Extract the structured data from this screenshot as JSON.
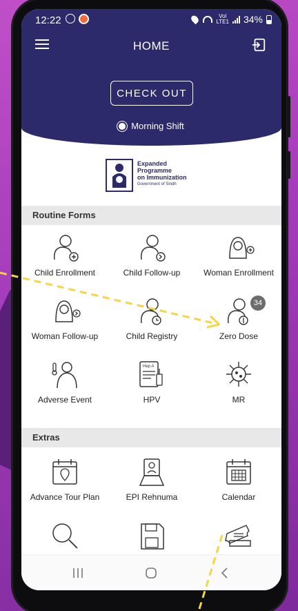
{
  "status_bar": {
    "time": "12:22",
    "battery": "34%",
    "network": "VoLTE LTE1"
  },
  "header": {
    "title": "HOME",
    "checkout_label": "CHECK OUT",
    "shift": "Morning Shift"
  },
  "logo": {
    "line1": "Expanded",
    "line2": "Programme",
    "line3": "on Immunization",
    "line4": "Government of Sindh"
  },
  "sections": {
    "routine": "Routine Forms",
    "extras": "Extras"
  },
  "routine_items": [
    {
      "label": "Child Enrollment",
      "icon": "child-plus-icon"
    },
    {
      "label": "Child Follow-up",
      "icon": "child-arrow-icon"
    },
    {
      "label": "Woman Enrollment",
      "icon": "woman-plus-icon"
    },
    {
      "label": "Woman Follow-up",
      "icon": "woman-arrow-icon"
    },
    {
      "label": "Child Registry",
      "icon": "child-clock-icon"
    },
    {
      "label": "Zero Dose",
      "icon": "zero-dose-icon",
      "badge": "34"
    },
    {
      "label": "Adverse Event",
      "icon": "adverse-event-icon"
    },
    {
      "label": "HPV",
      "icon": "hpv-vaccine-icon"
    },
    {
      "label": "MR",
      "icon": "virus-icon"
    }
  ],
  "extras_items": [
    {
      "label": "Advance Tour Plan",
      "icon": "calendar-pin-icon"
    },
    {
      "label": "EPI Rehnuma",
      "icon": "guide-icon"
    },
    {
      "label": "Calendar",
      "icon": "calendar-icon"
    },
    {
      "label": "",
      "icon": "search-icon"
    },
    {
      "label": "",
      "icon": "save-icon"
    },
    {
      "label": "",
      "icon": "ticket-icon"
    }
  ],
  "colors": {
    "header": "#2d2a6b",
    "badge": "#6c6c6c",
    "annotation_arrow": "#f6d44a"
  }
}
